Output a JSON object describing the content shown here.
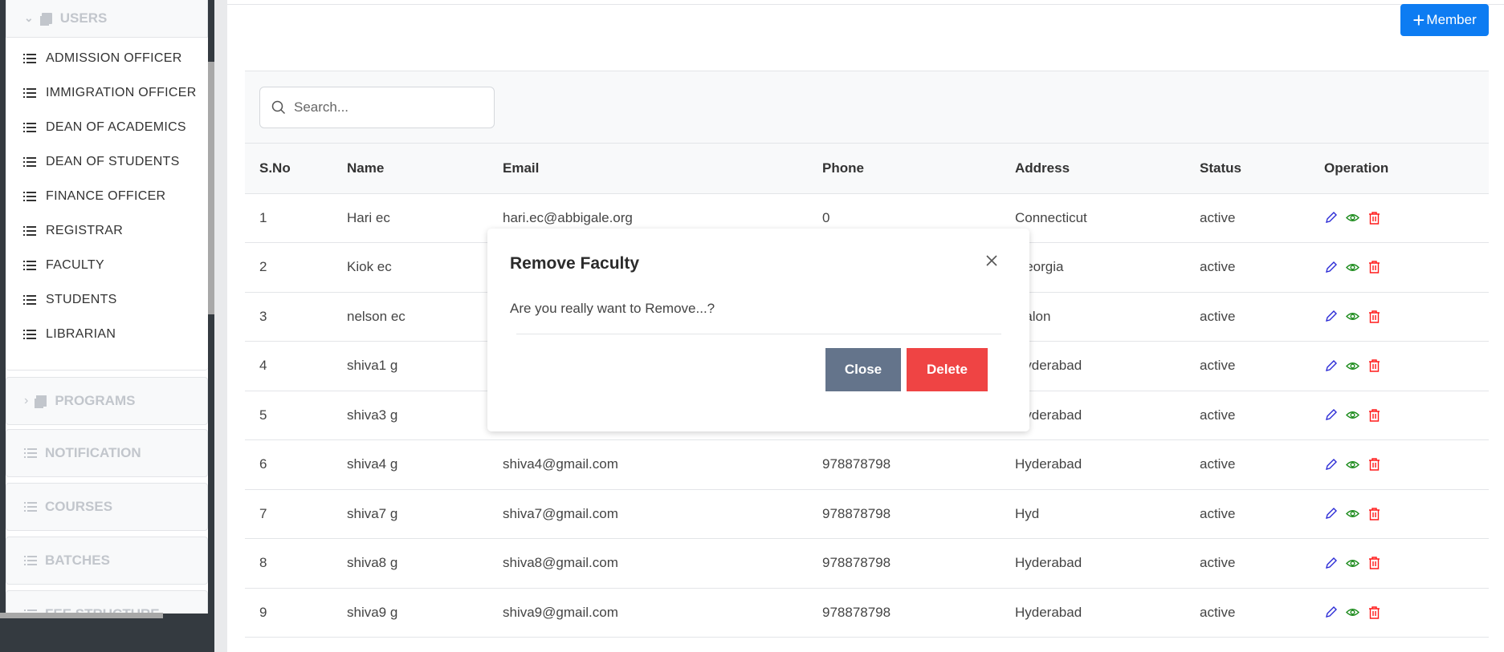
{
  "sidebar": {
    "users_header": "USERS",
    "items": [
      {
        "label": "ADMISSION OFFICER"
      },
      {
        "label": "IMMIGRATION OFFICER"
      },
      {
        "label": "DEAN OF ACADEMICS"
      },
      {
        "label": "DEAN OF STUDENTS"
      },
      {
        "label": "FINANCE OFFICER"
      },
      {
        "label": "REGISTRAR"
      },
      {
        "label": "FACULTY"
      },
      {
        "label": "STUDENTS"
      },
      {
        "label": "LIBRARIAN"
      }
    ],
    "sections": [
      {
        "label": "PROGRAMS",
        "icon": "chevron-right-icon"
      },
      {
        "label": "NOTIFICATION",
        "icon": "list-icon"
      },
      {
        "label": "COURSES",
        "icon": "list-icon"
      },
      {
        "label": "BATCHES",
        "icon": "list-icon"
      },
      {
        "label": "FEE STRUCTURE",
        "icon": "list-icon"
      }
    ]
  },
  "toolbar": {
    "add_member_label": "Member",
    "accent": "#0d7cf2"
  },
  "search": {
    "placeholder": "Search...",
    "value": ""
  },
  "table": {
    "columns": [
      "S.No",
      "Name",
      "Email",
      "Phone",
      "Address",
      "Status",
      "Operation"
    ],
    "rows": [
      {
        "sno": "1",
        "name": "Hari ec",
        "email": "hari.ec@abbigale.org",
        "phone": "0",
        "address": "Connecticut",
        "status": "active"
      },
      {
        "sno": "2",
        "name": "Kiok ec",
        "email": "",
        "phone": "",
        "address": "Georgia",
        "status": "active"
      },
      {
        "sno": "3",
        "name": "nelson ec",
        "email": "",
        "phone": "",
        "address": "Halon",
        "status": "active"
      },
      {
        "sno": "4",
        "name": "shiva1 g",
        "email": "",
        "phone": "",
        "address": "Hyderabad",
        "status": "active"
      },
      {
        "sno": "5",
        "name": "shiva3 g",
        "email": "",
        "phone": "",
        "address": "Hyderabad",
        "status": "active"
      },
      {
        "sno": "6",
        "name": "shiva4 g",
        "email": "shiva4@gmail.com",
        "phone": "978878798",
        "address": "Hyderabad",
        "status": "active"
      },
      {
        "sno": "7",
        "name": "shiva7 g",
        "email": "shiva7@gmail.com",
        "phone": "978878798",
        "address": "Hyd",
        "status": "active"
      },
      {
        "sno": "8",
        "name": "shiva8 g",
        "email": "shiva8@gmail.com",
        "phone": "978878798",
        "address": "Hyderabad",
        "status": "active"
      },
      {
        "sno": "9",
        "name": "shiva9 g",
        "email": "shiva9@gmail.com",
        "phone": "978878798",
        "address": "Hyderabad",
        "status": "active"
      }
    ],
    "operation_colors": {
      "edit": "#2b2bd6",
      "view": "#1a8a1a",
      "delete": "#ff1a1a"
    }
  },
  "modal": {
    "title": "Remove Faculty",
    "message": "Are you really want to Remove...?",
    "close_label": "Close",
    "delete_label": "Delete",
    "close_color": "#64748b",
    "delete_color": "#ef4444"
  }
}
